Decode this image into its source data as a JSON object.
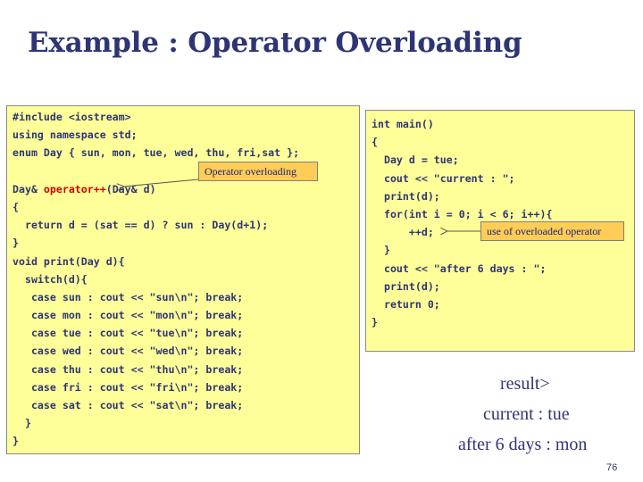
{
  "slide": {
    "title": "Example : Operator Overloading",
    "page_number": "76"
  },
  "left_code": {
    "lines": [
      "#include <iostream>",
      "using namespace std;",
      "enum Day { sun, mon, tue, wed, thu, fri,sat };",
      "",
      "Day& |operator++|(Day& d)",
      "{",
      "  return d = (sat == d) ? sun : Day(d+1);",
      "}",
      "void print(Day d){",
      "  switch(d){",
      "   case sun : cout << \"sun\\n\"; break;",
      "   case mon : cout << \"mon\\n\"; break;",
      "   case tue : cout << \"tue\\n\"; break;",
      "   case wed : cout << \"wed\\n\"; break;",
      "   case thu : cout << \"thu\\n\"; break;",
      "   case fri : cout << \"fri\\n\"; break;",
      "   case sat : cout << \"sat\\n\"; break;",
      "  }",
      "}"
    ]
  },
  "right_code": {
    "lines": [
      "int main()",
      "{",
      "  Day d = tue;",
      "  cout << \"current : \";",
      "  print(d);",
      "  for(int i = 0; i < 6; i++){",
      "      ++d;",
      "  }",
      "  cout << \"after 6 days : \";",
      "  print(d);",
      "  return 0;",
      "}"
    ]
  },
  "callouts": {
    "operator_overloading": "Operator overloading",
    "use_of_overloaded": "use of overloaded operator"
  },
  "result": {
    "heading": "result>",
    "line1": "current : tue",
    "line2": "after 6 days : mon"
  },
  "colors": {
    "title": "#2e3575",
    "code_background": "#ffff99",
    "callout_background": "#ffcc55",
    "keyword_highlight": "#d40000"
  }
}
